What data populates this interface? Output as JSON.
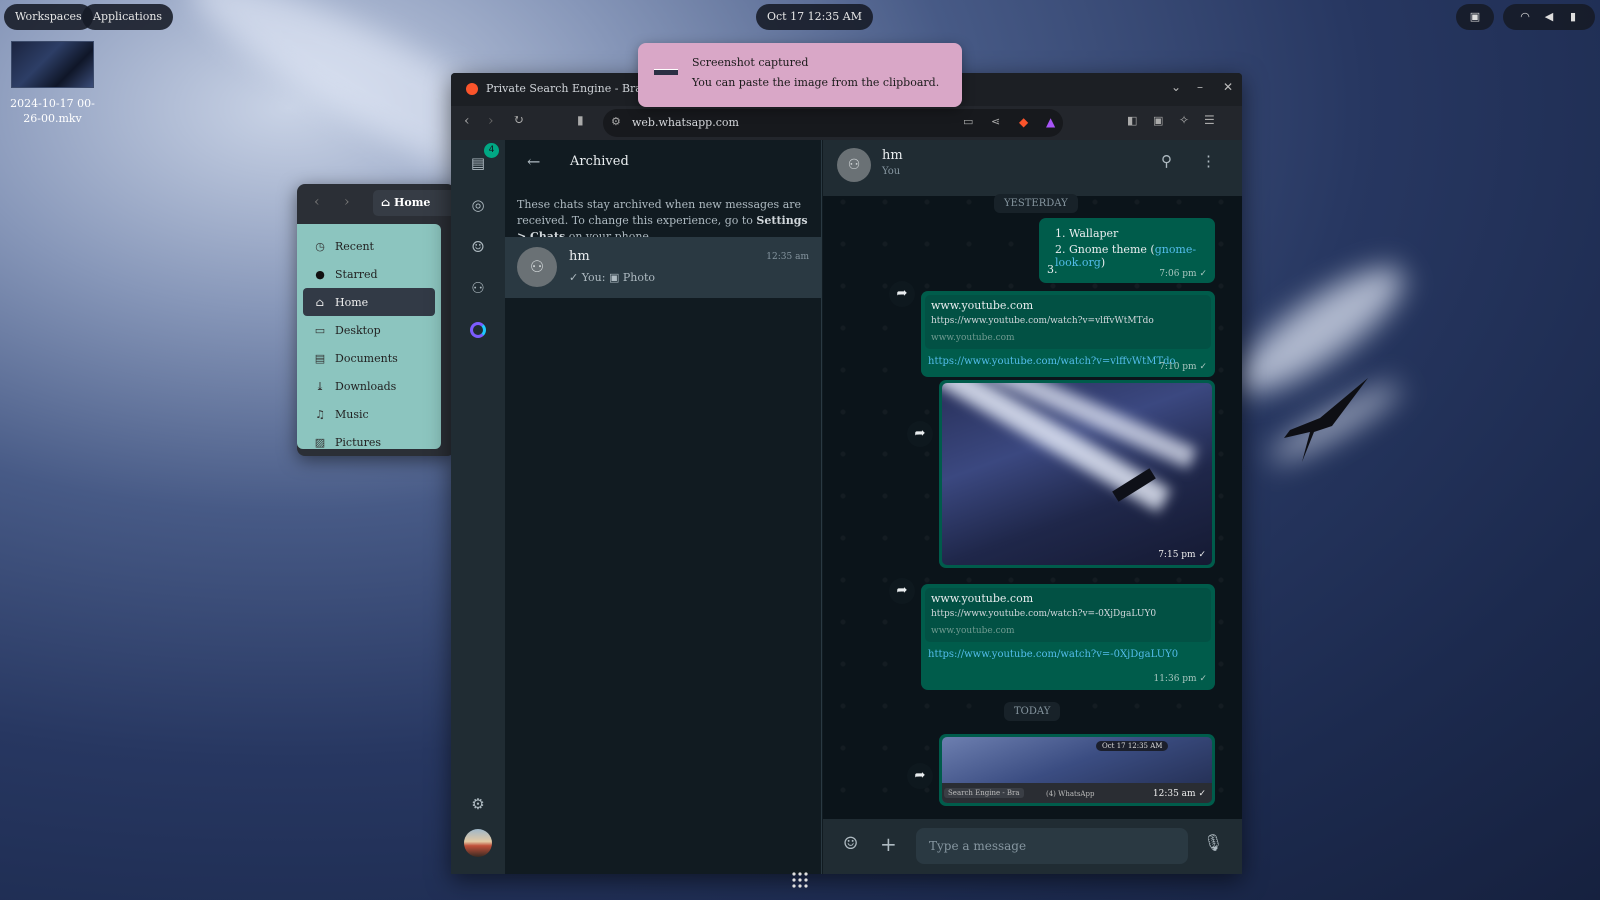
{
  "topbar": {
    "workspaces": "Workspaces",
    "applications": "Applications",
    "clock": "Oct 17  12:35 AM"
  },
  "desktop": {
    "file_label": "2024-10-17 00-26-00.mkv"
  },
  "notification": {
    "title": "Screenshot captured",
    "body": "You can paste the image from the clipboard."
  },
  "files": {
    "location": "Home",
    "items": [
      {
        "icon": "clock-icon",
        "label": "Recent"
      },
      {
        "icon": "star-icon",
        "label": "Starred"
      },
      {
        "icon": "home-icon",
        "label": "Home"
      },
      {
        "icon": "desktop-icon",
        "label": "Desktop"
      },
      {
        "icon": "documents-icon",
        "label": "Documents"
      },
      {
        "icon": "download-icon",
        "label": "Downloads"
      },
      {
        "icon": "music-icon",
        "label": "Music"
      },
      {
        "icon": "pictures-icon",
        "label": "Pictures"
      }
    ]
  },
  "browser": {
    "tab_title": "Private Search Engine - Brave S",
    "url": "web.whatsapp.com"
  },
  "whatsapp": {
    "rail_badge": "4",
    "archived": {
      "title": "Archived",
      "notice_pre": "These chats stay archived when new messages are received. To change this experience, go to ",
      "notice_link": "Settings > Chats",
      "notice_post": " on your phone."
    },
    "chat_list": [
      {
        "name": "hm",
        "time": "12:35 am",
        "preview_prefix": "You:",
        "preview": "Photo"
      }
    ],
    "conversation": {
      "name": "hm",
      "subtitle": "You",
      "day_yesterday": "YESTERDAY",
      "day_today": "TODAY",
      "msg1": {
        "item1": "Wallaper",
        "item2_pre": "Gnome theme (",
        "item2_link": "gnome-look.org",
        "item2_post": ")",
        "item3": "3.",
        "time": "7:06 pm"
      },
      "msg2": {
        "site": "www.youtube.com",
        "url": "https://www.youtube.com/watch?v=vlffvWtMTdo",
        "domain": "www.youtube.com",
        "link": "https://www.youtube.com/watch?v=vlffvWtMTdo",
        "time": "7:10 pm"
      },
      "msg3": {
        "time": "7:15 pm"
      },
      "msg4": {
        "site": "www.youtube.com",
        "url": "https://www.youtube.com/watch?v=-0XjDgaLUY0",
        "domain": "www.youtube.com",
        "link": "https://www.youtube.com/watch?v=-0XjDgaLUY0",
        "time": "11:36 pm"
      },
      "msg5": {
        "thumb_clock": "Oct 17  12:35 AM",
        "thumb_tab1": "Search Engine - Bra",
        "thumb_tab2": "(4) WhatsApp",
        "time": "12:35 am"
      }
    },
    "composer_placeholder": "Type a message"
  },
  "colors": {
    "wa_bubble": "#005c4b",
    "wa_link": "#53bdeb",
    "files_sidebar": "#8cc5bf",
    "notification": "#d9a7c7"
  }
}
